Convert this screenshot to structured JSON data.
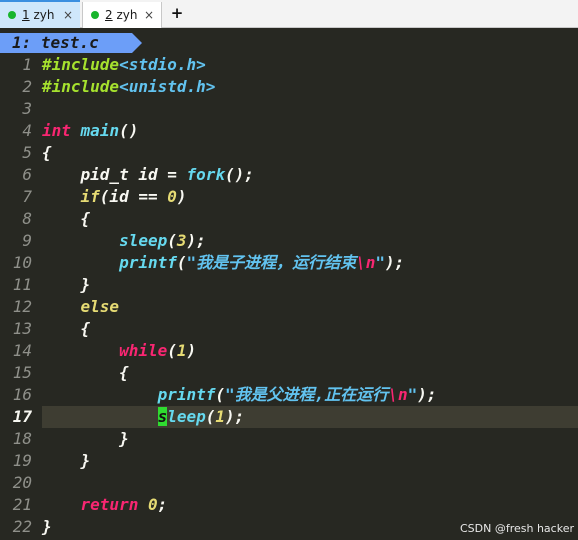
{
  "tabs": [
    {
      "number": "1",
      "name": " zyh",
      "close": "×",
      "active": true
    },
    {
      "number": "2",
      "name": " zyh",
      "close": "×",
      "active": false
    }
  ],
  "add_tab": "+",
  "bufferline": {
    "label": "1: test.c"
  },
  "colors": {
    "background": "#272822",
    "cursorline": "#3e3d32",
    "buffer_tab": "#6c9ef8",
    "preproc": "#a6e22e",
    "string": "#62c3f0",
    "keyword": "#f92672",
    "type": "#f92672",
    "function": "#66d9ef",
    "number": "#e6db74",
    "cursor": "#2fdc30"
  },
  "editor": {
    "current_line": 17,
    "lines": [
      {
        "n": "1",
        "tokens": [
          [
            "#include",
            "#a6e22e"
          ],
          [
            "<stdio.h>",
            "#62c3f0"
          ]
        ]
      },
      {
        "n": "2",
        "tokens": [
          [
            "#include",
            "#a6e22e"
          ],
          [
            "<unistd.h>",
            "#62c3f0"
          ]
        ]
      },
      {
        "n": "3",
        "tokens": []
      },
      {
        "n": "4",
        "tokens": [
          [
            "int",
            "#f92672"
          ],
          [
            " ",
            ""
          ],
          [
            "main",
            "#66d9ef"
          ],
          [
            "()",
            "#f8f8f2"
          ]
        ]
      },
      {
        "n": "5",
        "tokens": [
          [
            "{",
            "#f8f8f2"
          ]
        ]
      },
      {
        "n": "6",
        "tokens": [
          [
            "    pid_t id = ",
            "#f8f8f2"
          ],
          [
            "fork",
            "#66d9ef"
          ],
          [
            "();",
            "#f8f8f2"
          ]
        ]
      },
      {
        "n": "7",
        "tokens": [
          [
            "    ",
            ""
          ],
          [
            "if",
            "#e6db74"
          ],
          [
            "(id == ",
            "#f8f8f2"
          ],
          [
            "0",
            "#e6db74"
          ],
          [
            ")",
            "#f8f8f2"
          ]
        ]
      },
      {
        "n": "8",
        "tokens": [
          [
            "    {",
            "#f8f8f2"
          ]
        ]
      },
      {
        "n": "9",
        "tokens": [
          [
            "        ",
            ""
          ],
          [
            "sleep",
            "#66d9ef"
          ],
          [
            "(",
            "#f8f8f2"
          ],
          [
            "3",
            "#e6db74"
          ],
          [
            ");",
            "#f8f8f2"
          ]
        ]
      },
      {
        "n": "10",
        "tokens": [
          [
            "        ",
            ""
          ],
          [
            "printf",
            "#66d9ef"
          ],
          [
            "(",
            "#f8f8f2"
          ],
          [
            "\"我是子进程，运行结束",
            "#62c3f0"
          ],
          [
            "\\n",
            "#f92672"
          ],
          [
            "\"",
            "#62c3f0"
          ],
          [
            ");",
            "#f8f8f2"
          ]
        ]
      },
      {
        "n": "11",
        "tokens": [
          [
            "    }",
            "#f8f8f2"
          ]
        ]
      },
      {
        "n": "12",
        "tokens": [
          [
            "    ",
            ""
          ],
          [
            "else",
            "#e6db74"
          ]
        ]
      },
      {
        "n": "13",
        "tokens": [
          [
            "    {",
            "#f8f8f2"
          ]
        ]
      },
      {
        "n": "14",
        "tokens": [
          [
            "        ",
            ""
          ],
          [
            "while",
            "#f92672"
          ],
          [
            "(",
            "#f8f8f2"
          ],
          [
            "1",
            "#e6db74"
          ],
          [
            ")",
            "#f8f8f2"
          ]
        ]
      },
      {
        "n": "15",
        "tokens": [
          [
            "        {",
            "#f8f8f2"
          ]
        ]
      },
      {
        "n": "16",
        "tokens": [
          [
            "            ",
            ""
          ],
          [
            "printf",
            "#66d9ef"
          ],
          [
            "(",
            "#f8f8f2"
          ],
          [
            "\"我是父进程,正在运行",
            "#62c3f0"
          ],
          [
            "\\n",
            "#f92672"
          ],
          [
            "\"",
            "#62c3f0"
          ],
          [
            ");",
            "#f8f8f2"
          ]
        ]
      },
      {
        "n": "17",
        "tokens": [
          [
            "            ",
            ""
          ],
          [
            "s",
            "cursor"
          ],
          [
            "leep",
            "#66d9ef"
          ],
          [
            "(",
            "#f8f8f2"
          ],
          [
            "1",
            "#e6db74"
          ],
          [
            ");",
            "#f8f8f2"
          ]
        ]
      },
      {
        "n": "18",
        "tokens": [
          [
            "        }",
            "#f8f8f2"
          ]
        ]
      },
      {
        "n": "19",
        "tokens": [
          [
            "    }",
            "#f8f8f2"
          ]
        ]
      },
      {
        "n": "20",
        "tokens": []
      },
      {
        "n": "21",
        "tokens": [
          [
            "    ",
            ""
          ],
          [
            "return",
            "#f92672"
          ],
          [
            " ",
            ""
          ],
          [
            "0",
            "#e6db74"
          ],
          [
            ";",
            "#f8f8f2"
          ]
        ]
      },
      {
        "n": "22",
        "tokens": [
          [
            "}",
            "#f8f8f2"
          ]
        ]
      }
    ]
  },
  "watermark": "CSDN @fresh hacker"
}
